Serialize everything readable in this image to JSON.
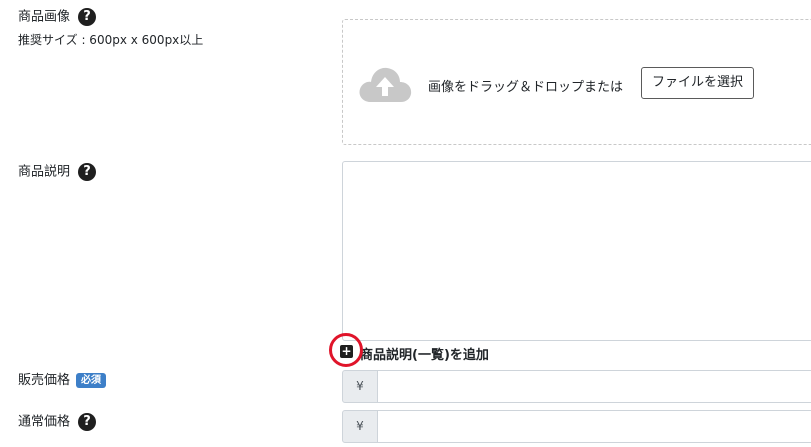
{
  "image_field": {
    "label": "商品画像",
    "help": "?",
    "size_hint": "推奨サイズ : 600px x 600px以上",
    "dropzone_text": "画像をドラッグ＆ドロップまたは",
    "file_button": "ファイルを選択"
  },
  "description_field": {
    "label": "商品説明",
    "help": "?",
    "value": ""
  },
  "add_description": {
    "label": "商品説明(一覧)を追加",
    "icon_glyph": "+"
  },
  "sale_price": {
    "label": "販売価格",
    "required_badge": "必須",
    "currency": "¥",
    "value": ""
  },
  "regular_price": {
    "label": "通常価格",
    "help": "?",
    "currency": "¥",
    "value": ""
  },
  "colors": {
    "highlight_circle": "#e0142a",
    "badge": "#3d7fc8"
  }
}
